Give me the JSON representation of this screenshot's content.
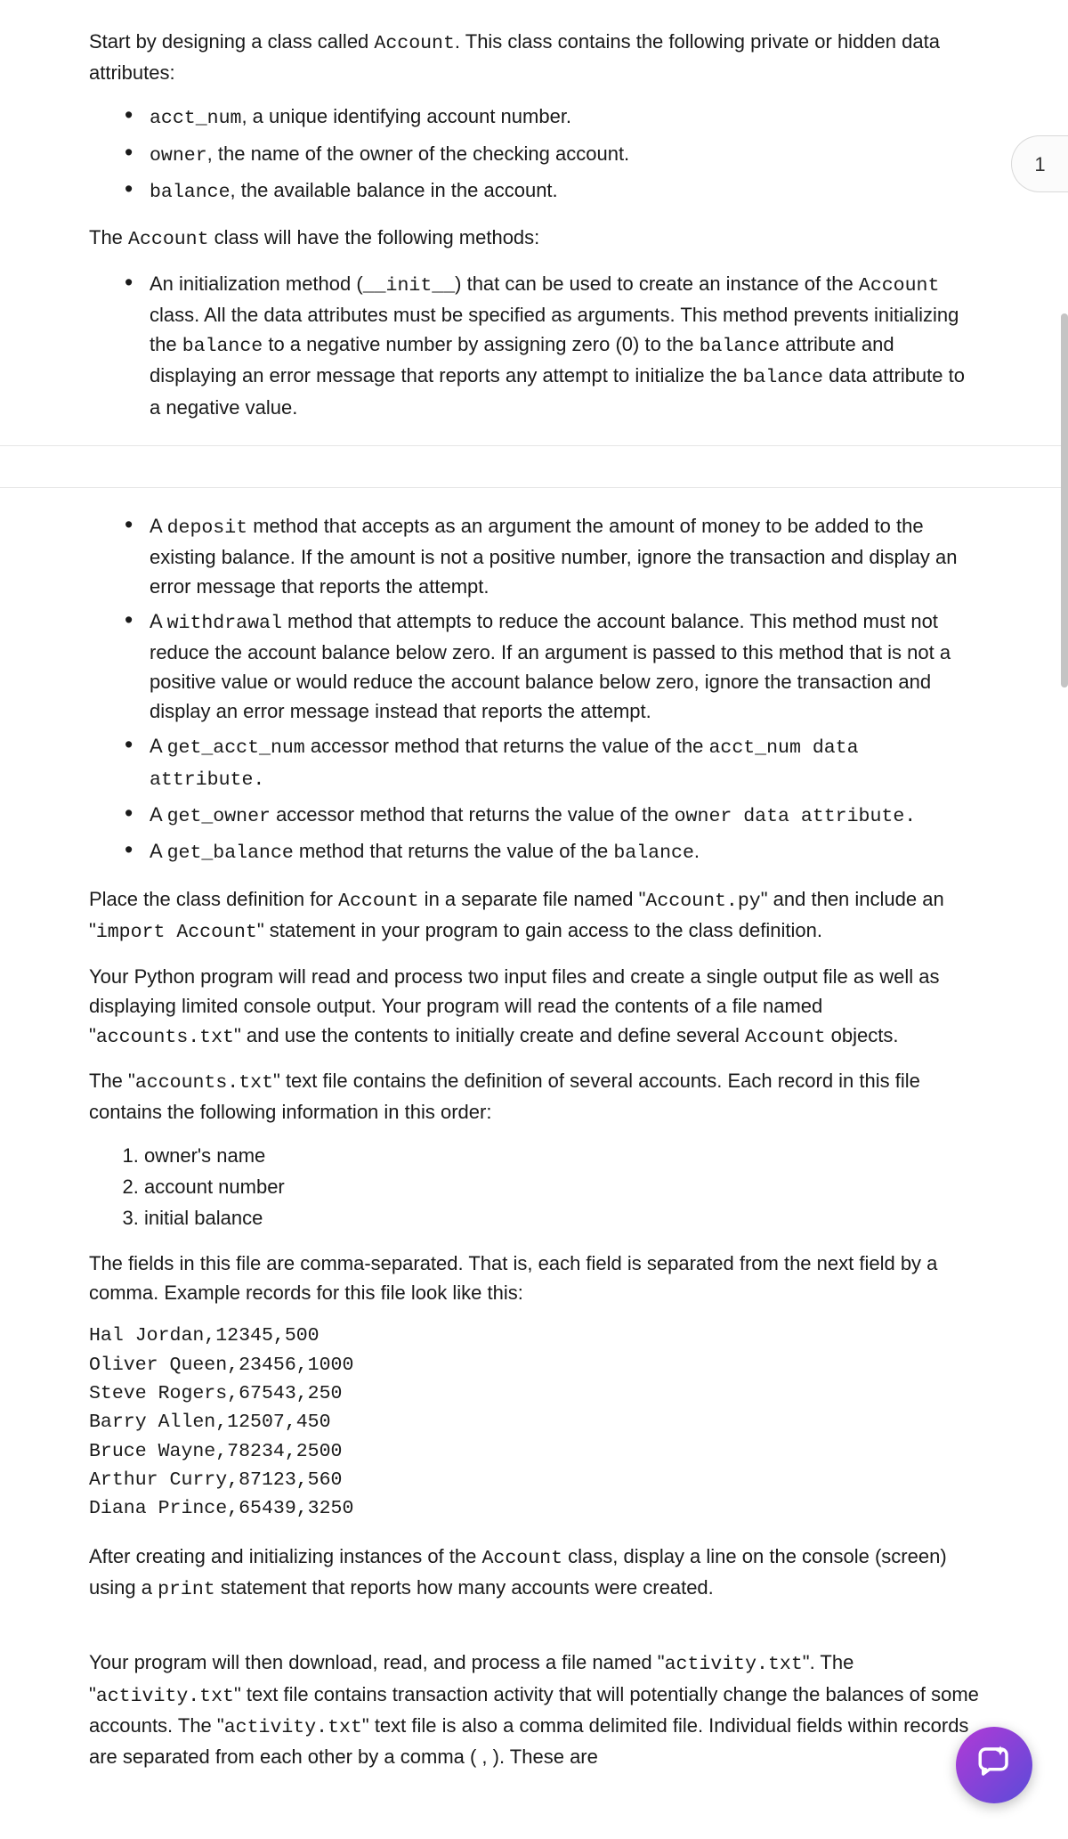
{
  "badge": {
    "label": "1"
  },
  "intro": {
    "p1_a": "Start by designing a class called ",
    "p1_code": "Account",
    "p1_b": ". This class contains the following private or hidden data attributes:"
  },
  "attrs": [
    {
      "code": "acct_num",
      "text": ", a unique identifying account number."
    },
    {
      "code": "owner",
      "text": ", the name of the owner of the checking account."
    },
    {
      "code": "balance",
      "text": ", the available balance in the account."
    }
  ],
  "methods_intro_a": "The ",
  "methods_intro_code": "Account",
  "methods_intro_b": " class will have the following methods:",
  "method_init": {
    "a": "An initialization method (",
    "code1": "__init__",
    "b": ") that can be used to create an instance of the ",
    "code2": "Account",
    "c": " class. All the data attributes must be specified as arguments. This method prevents initializing the ",
    "code3": "balance",
    "d": " to a negative number by assigning zero (0) to the ",
    "code4": "balance",
    "e": " attribute and displaying an error message that reports any attempt to initialize the ",
    "code5": "balance",
    "f": " data attribute to a negative value."
  },
  "method_deposit": {
    "a": "A ",
    "code1": "deposit",
    "b": " method that accepts as an argument the amount of money to be added to the existing balance. If the amount is not a positive number, ignore the transaction and display an error message that reports the attempt."
  },
  "method_withdrawal": {
    "a": "A ",
    "code1": "withdrawal",
    "b": " method that attempts to reduce the account balance. This method must not reduce the account balance below zero. If an argument is passed to this method that is not a positive value or would reduce the account balance below zero, ignore the transaction and display an error message instead that reports the attempt."
  },
  "method_get_acct": {
    "a": "A ",
    "code1": "get_acct_num",
    "b": " accessor method that returns the value of the ",
    "code2": "acct_num data attribute."
  },
  "method_get_owner": {
    "a": "A ",
    "code1": "get_owner",
    "b": " accessor method that returns the value of the ",
    "code2": "owner data attribute."
  },
  "method_get_balance": {
    "a": "A ",
    "code1": "get_balance",
    "b": " method that returns the value of the ",
    "code2": "balance",
    "c": "."
  },
  "place_para": {
    "a": "Place the class definition for ",
    "code1": "Account",
    "b": " in a separate file named \"",
    "code2": "Account.py",
    "c": "\" and then include an \"",
    "code3": "import Account",
    "d": "\" statement in your program to gain access to the class definition."
  },
  "read_para": {
    "a": "Your Python program will read and process two input files and create a single output file as well as displaying limited console output. Your program will read the contents of a file named \"",
    "code1": "accounts.txt",
    "b": "\" and use the contents to initially create and define several ",
    "code2": "Account",
    "c": " objects."
  },
  "accounts_file_para": {
    "a": "The \"",
    "code1": "accounts.txt",
    "b": "\" text file contains the definition of several accounts. Each record in this file contains the following information in this order:"
  },
  "record_fields": [
    "owner's name",
    "account number",
    "initial balance"
  ],
  "fields_para": "The fields in this file are comma-separated. That is, each field is separated from the next field by a comma. Example records for this file look like this:",
  "example_records": "Hal Jordan,12345,500\nOliver Queen,23456,1000\nSteve Rogers,67543,250\nBarry Allen,12507,450\nBruce Wayne,78234,2500\nArthur Curry,87123,560\nDiana Prince,65439,3250",
  "after_para": {
    "a": "After creating and initializing instances of the ",
    "code1": "Account",
    "b": " class, display a line on the console (screen) using a ",
    "code2": "print",
    "c": " statement that reports how many accounts were created."
  },
  "activity_para": {
    "a": "Your program will then download, read, and process a file named \"",
    "code1": "activity.txt",
    "b": "\". The \"",
    "code2": "activity.txt",
    "c": "\" text file contains transaction activity that will potentially change the balances of some accounts. The \"",
    "code3": "activity.txt",
    "d": "\" text file is also a comma delimited file. Individual fields within records are separated from each other by a comma ( , ). These are"
  }
}
